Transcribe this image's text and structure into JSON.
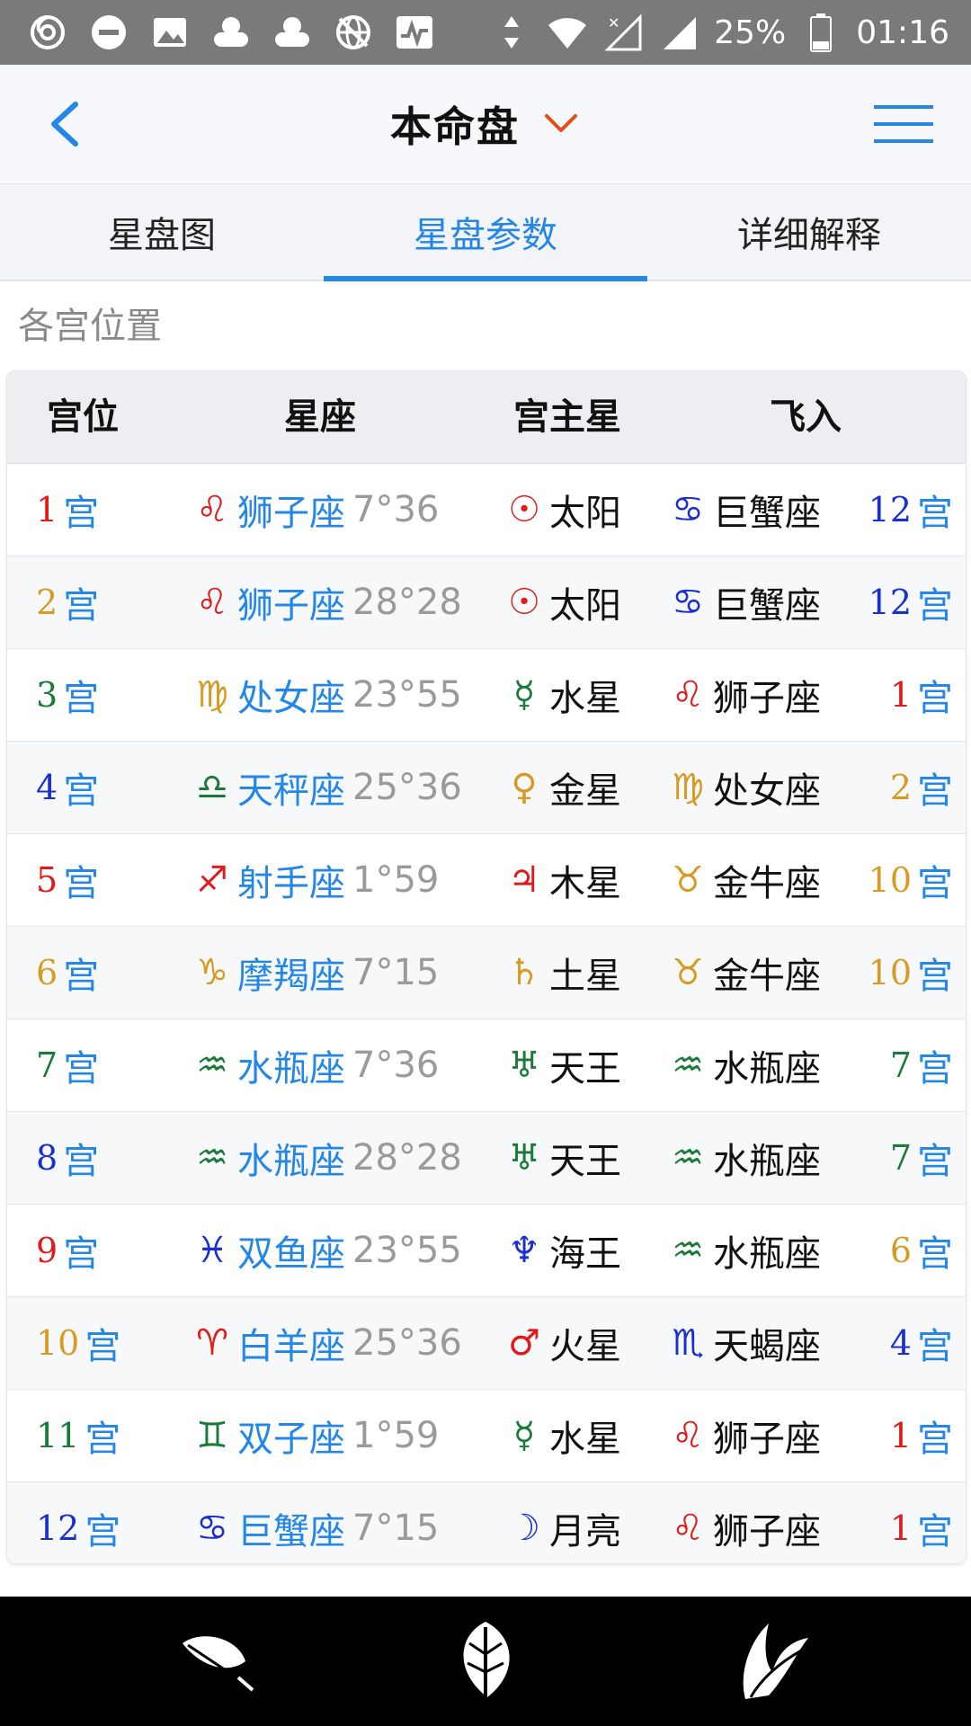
{
  "status_bar": {
    "battery_percent": "25%",
    "time": "01:16",
    "left_icons": [
      "netease-icon",
      "minus-circle-icon",
      "image-icon",
      "cloud-icon",
      "cloud-icon",
      "globe-off-icon",
      "activity-icon"
    ],
    "right_icons": [
      "data-arrows-icon",
      "wifi-icon",
      "signal-none-icon",
      "signal-icon",
      "battery-icon"
    ]
  },
  "header": {
    "title": "本命盘"
  },
  "tabs": [
    {
      "label": "星盘图",
      "active": false
    },
    {
      "label": "星盘参数",
      "active": true
    },
    {
      "label": "详细解释",
      "active": false
    }
  ],
  "section": {
    "title": "各宫位置"
  },
  "table": {
    "headers": [
      "宫位",
      "星座",
      "宫主星",
      "飞入"
    ],
    "gong_label": "宫",
    "rows": [
      {
        "house": "1",
        "house_color": "#e01b1b",
        "sign_glyph": "♌",
        "sign_color": "#e01b1b",
        "sign": "狮子座",
        "degree": "7°36",
        "ruler_glyph": "☉",
        "ruler_color": "#e01b1b",
        "ruler": "太阳",
        "fly_glyph": "♋",
        "fly_color": "#1a2fd1",
        "fly_sign": "巨蟹座",
        "fly_house": "12",
        "fly_house_color": "#1a2fd1"
      },
      {
        "house": "2",
        "house_color": "#d79a22",
        "sign_glyph": "♌",
        "sign_color": "#e01b1b",
        "sign": "狮子座",
        "degree": "28°28",
        "ruler_glyph": "☉",
        "ruler_color": "#e01b1b",
        "ruler": "太阳",
        "fly_glyph": "♋",
        "fly_color": "#1a2fd1",
        "fly_sign": "巨蟹座",
        "fly_house": "12",
        "fly_house_color": "#1a2fd1"
      },
      {
        "house": "3",
        "house_color": "#1b7a3a",
        "sign_glyph": "♍",
        "sign_color": "#d79a22",
        "sign": "处女座",
        "degree": "23°55",
        "ruler_glyph": "☿",
        "ruler_color": "#1b7a3a",
        "ruler": "水星",
        "fly_glyph": "♌",
        "fly_color": "#e01b1b",
        "fly_sign": "狮子座",
        "fly_house": "1",
        "fly_house_color": "#e01b1b"
      },
      {
        "house": "4",
        "house_color": "#1a2fd1",
        "sign_glyph": "♎",
        "sign_color": "#1b7a3a",
        "sign": "天秤座",
        "degree": "25°36",
        "ruler_glyph": "♀",
        "ruler_color": "#d79a22",
        "ruler": "金星",
        "fly_glyph": "♍",
        "fly_color": "#d79a22",
        "fly_sign": "处女座",
        "fly_house": "2",
        "fly_house_color": "#d79a22"
      },
      {
        "house": "5",
        "house_color": "#e01b1b",
        "sign_glyph": "♐",
        "sign_color": "#e01b1b",
        "sign": "射手座",
        "degree": "1°59",
        "ruler_glyph": "♃",
        "ruler_color": "#e01b1b",
        "ruler": "木星",
        "fly_glyph": "♉",
        "fly_color": "#d79a22",
        "fly_sign": "金牛座",
        "fly_house": "10",
        "fly_house_color": "#d79a22"
      },
      {
        "house": "6",
        "house_color": "#d79a22",
        "sign_glyph": "♑",
        "sign_color": "#d79a22",
        "sign": "摩羯座",
        "degree": "7°15",
        "ruler_glyph": "♄",
        "ruler_color": "#d79a22",
        "ruler": "土星",
        "fly_glyph": "♉",
        "fly_color": "#d79a22",
        "fly_sign": "金牛座",
        "fly_house": "10",
        "fly_house_color": "#d79a22"
      },
      {
        "house": "7",
        "house_color": "#1b7a3a",
        "sign_glyph": "♒",
        "sign_color": "#1b7a3a",
        "sign": "水瓶座",
        "degree": "7°36",
        "ruler_glyph": "♅",
        "ruler_color": "#1b7a3a",
        "ruler": "天王",
        "fly_glyph": "♒",
        "fly_color": "#1b7a3a",
        "fly_sign": "水瓶座",
        "fly_house": "7",
        "fly_house_color": "#1b7a3a"
      },
      {
        "house": "8",
        "house_color": "#1a2fd1",
        "sign_glyph": "♒",
        "sign_color": "#1b7a3a",
        "sign": "水瓶座",
        "degree": "28°28",
        "ruler_glyph": "♅",
        "ruler_color": "#1b7a3a",
        "ruler": "天王",
        "fly_glyph": "♒",
        "fly_color": "#1b7a3a",
        "fly_sign": "水瓶座",
        "fly_house": "7",
        "fly_house_color": "#1b7a3a"
      },
      {
        "house": "9",
        "house_color": "#e01b1b",
        "sign_glyph": "♓",
        "sign_color": "#1a2fd1",
        "sign": "双鱼座",
        "degree": "23°55",
        "ruler_glyph": "♆",
        "ruler_color": "#1a2fd1",
        "ruler": "海王",
        "fly_glyph": "♒",
        "fly_color": "#1b7a3a",
        "fly_sign": "水瓶座",
        "fly_house": "6",
        "fly_house_color": "#d79a22"
      },
      {
        "house": "10",
        "house_color": "#d79a22",
        "sign_glyph": "♈",
        "sign_color": "#e01b1b",
        "sign": "白羊座",
        "degree": "25°36",
        "ruler_glyph": "♂",
        "ruler_color": "#e01b1b",
        "ruler": "火星",
        "fly_glyph": "♏",
        "fly_color": "#1a2fd1",
        "fly_sign": "天蝎座",
        "fly_house": "4",
        "fly_house_color": "#1a2fd1"
      },
      {
        "house": "11",
        "house_color": "#1b7a3a",
        "sign_glyph": "♊",
        "sign_color": "#1b7a3a",
        "sign": "双子座",
        "degree": "1°59",
        "ruler_glyph": "☿",
        "ruler_color": "#1b7a3a",
        "ruler": "水星",
        "fly_glyph": "♌",
        "fly_color": "#e01b1b",
        "fly_sign": "狮子座",
        "fly_house": "1",
        "fly_house_color": "#e01b1b"
      },
      {
        "house": "12",
        "house_color": "#1a2fd1",
        "sign_glyph": "♋",
        "sign_color": "#1a2fd1",
        "sign": "巨蟹座",
        "degree": "7°15",
        "ruler_glyph": "☽",
        "ruler_color": "#1a2fd1",
        "ruler": "月亮",
        "fly_glyph": "♌",
        "fly_color": "#e01b1b",
        "fly_sign": "狮子座",
        "fly_house": "1",
        "fly_house_color": "#e01b1b"
      }
    ]
  },
  "bottom_nav": [
    "feather-leaf-icon",
    "leaf-icon",
    "palm-leaf-icon"
  ],
  "colors": {
    "accent": "#2486e6",
    "red": "#e01b1b",
    "gold": "#d79a22",
    "green": "#1b7a3a",
    "blue": "#1a2fd1"
  }
}
